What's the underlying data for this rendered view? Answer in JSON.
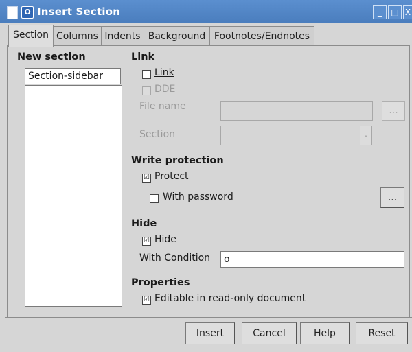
{
  "window": {
    "title": "Insert Section",
    "app_icon": "O",
    "doc_icon": "document-icon",
    "minimize": "_",
    "maximize": "□",
    "close": "X"
  },
  "tabs": [
    "Section",
    "Columns",
    "Indents",
    "Background",
    "Footnotes/Endnotes"
  ],
  "new_section": {
    "heading": "New section",
    "name_value": "Section-sidebar"
  },
  "link": {
    "heading": "Link",
    "link_label": "Link",
    "link_checked": false,
    "dde_label": "DDE",
    "dde_checked": false,
    "file_name_label": "File name",
    "file_name_value": "",
    "browse_label": "...",
    "section_label": "Section",
    "section_value": ""
  },
  "write_protection": {
    "heading": "Write protection",
    "protect_label": "Protect",
    "protect_checked": true,
    "password_label": "With password",
    "password_checked": false,
    "password_button": "..."
  },
  "hide": {
    "heading": "Hide",
    "hide_label": "Hide",
    "hide_checked": true,
    "condition_label": "With Condition",
    "condition_value": "o"
  },
  "properties": {
    "heading": "Properties",
    "editable_label": "Editable in read-only document",
    "editable_checked": true
  },
  "buttons": {
    "insert": "Insert",
    "cancel": "Cancel",
    "help": "Help",
    "reset": "Reset"
  },
  "check_mark": "☑"
}
